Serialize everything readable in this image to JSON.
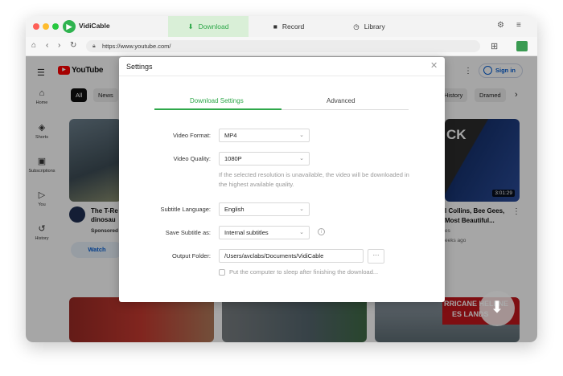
{
  "app": {
    "name": "VidiCable"
  },
  "top_tabs": [
    {
      "label": "Download",
      "icon": "download-icon",
      "active": true
    },
    {
      "label": "Record",
      "icon": "camera-icon",
      "active": false
    },
    {
      "label": "Library",
      "icon": "clock-icon",
      "active": false
    }
  ],
  "address": {
    "url": "https://www.youtube.com/"
  },
  "youtube": {
    "logo": "YouTube",
    "signin": "Sign in",
    "sidebar": [
      {
        "label": "Home",
        "icon": "home-icon"
      },
      {
        "label": "Shorts",
        "icon": "shorts-icon"
      },
      {
        "label": "Subscriptions",
        "icon": "subscriptions-icon"
      },
      {
        "label": "You",
        "icon": "you-icon"
      },
      {
        "label": "History",
        "icon": "history-icon"
      }
    ],
    "chips": [
      "All",
      "News",
      "History",
      "Dramed"
    ],
    "video_left": {
      "title_line1": "The T-Re",
      "title_line2": "dinosau",
      "sponsored": "Sponsored",
      "action": "Watch"
    },
    "video_right": {
      "overlay_text": "CK",
      "duration": "3:01:29",
      "title_line1": "l Collins, Bee Gees,",
      "title_line2": "Most Beautiful...",
      "meta1": "es",
      "meta2": "eeks ago"
    },
    "video_bottom_right": {
      "overlay_line1": "RRICANE HELENE",
      "overlay_line2": "ES LANDS"
    }
  },
  "settings": {
    "title": "Settings",
    "tabs": {
      "download": "Download Settings",
      "advanced": "Advanced"
    },
    "video_format": {
      "label": "Video Format:",
      "value": "MP4"
    },
    "video_quality": {
      "label": "Video Quality:",
      "value": "1080P"
    },
    "quality_hint": "If the selected resolution is unavailable, the video will be downloaded in the highest available quality.",
    "subtitle_language": {
      "label": "Subtitle Language:",
      "value": "English"
    },
    "save_subtitle": {
      "label": "Save Subtitle as:",
      "value": "Internal subtitles"
    },
    "output_folder": {
      "label": "Output Folder:",
      "value": "/Users/avclabs/Documents/VidiCable",
      "browse": "···"
    },
    "sleep_option": "Put the computer to sleep after finishing the download..."
  },
  "colors": {
    "accent": "#2fa84a",
    "accent_bg": "#d9efd7",
    "youtube_red": "#ff0000",
    "link_blue": "#065fd4"
  }
}
